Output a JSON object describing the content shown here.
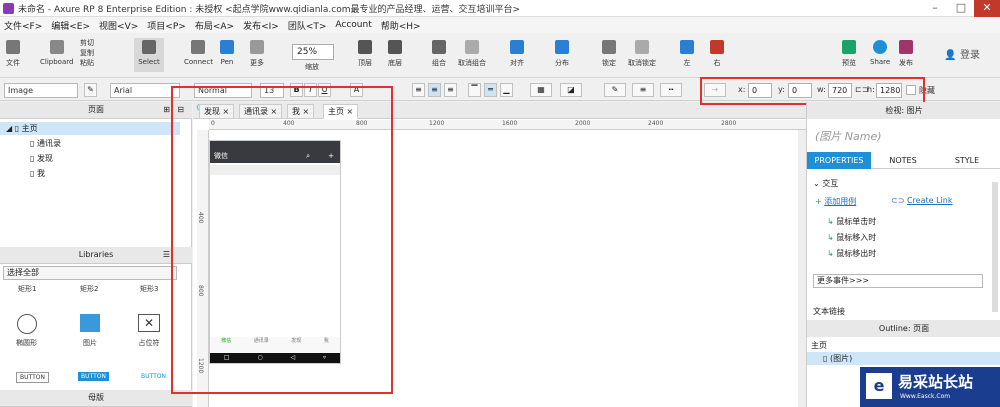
{
  "window": {
    "title": "未命名 - Axure RP 8 Enterprise Edition : 未授权   <起点学院www.qidianla.com最专业的产品经理、运营、交互培训平台>"
  },
  "menu": [
    "文件<F>",
    "编辑<E>",
    "视图<V>",
    "项目<P>",
    "布局<A>",
    "发布<I>",
    "团队<T>",
    "Account",
    "帮助<H>"
  ],
  "toolbar": {
    "file": "文件",
    "clipboard": "Clipboard",
    "cut": "剪切",
    "copy": "复制",
    "paste": "粘贴",
    "select": "Select",
    "connect": "Connect",
    "pen": "Pen",
    "more": "更多",
    "zoom": "25%",
    "zoom_label": "缩放",
    "top": "顶层",
    "bottom": "底层",
    "group": "组合",
    "ungroup": "取消组合",
    "align": "对齐",
    "distribute": "分布",
    "lock": "锁定",
    "unlock": "取消锁定",
    "left": "左",
    "right": "右",
    "preview": "预览",
    "share": "Share",
    "publish": "发布",
    "login": "登录"
  },
  "format": {
    "widget_type": "Image",
    "font": "Arial",
    "weight": "Normal",
    "size": "13",
    "x_label": "x:",
    "x": "0",
    "y_label": "y:",
    "y": "0",
    "w_label": "w:",
    "w": "720",
    "h_label": "h:",
    "h": "1280",
    "hidden": "隐藏"
  },
  "left": {
    "pages_title": "页面",
    "pages": [
      "主页",
      "通讯录",
      "发现",
      "我"
    ],
    "libraries_title": "Libraries",
    "lib_select": "选择全部",
    "widgets": [
      "矩形1",
      "矩形2",
      "矩形3",
      "椭圆形",
      "图片",
      "占位符",
      "BUTTON",
      "BUTTON",
      "BUTTON"
    ],
    "masters_title": "母版"
  },
  "canvas": {
    "tabs": [
      "发现",
      "通讯录",
      "我",
      "主页"
    ],
    "ruler_h": [
      "0",
      "400",
      "800",
      "1200",
      "1600",
      "2000",
      "2400",
      "2800"
    ],
    "ruler_v": [
      "400",
      "800",
      "1200"
    ],
    "phone_title": "微信",
    "phone_nav": [
      "微信",
      "通讯录",
      "发现",
      "我"
    ]
  },
  "right": {
    "inspector_title": "检视: 图片",
    "name_placeholder": "(图片 Name)",
    "tabs": [
      "PROPERTIES",
      "NOTES",
      "STYLE"
    ],
    "interaction": "交互",
    "add_case": "添加用例",
    "create_link": "Create Link",
    "events": [
      "鼠标单击时",
      "鼠标移入时",
      "鼠标移出时"
    ],
    "more_events": "更多事件>>>",
    "text_link": "文本链接",
    "outline_title": "Outline: 页面",
    "outline_items": [
      "主页",
      "(图片)"
    ]
  },
  "watermark": {
    "title": "易采站长站",
    "sub": "Www.Easck.Com"
  }
}
